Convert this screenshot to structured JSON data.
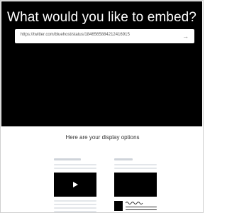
{
  "hero": {
    "title": "What would you like to embed?"
  },
  "url_input": {
    "value": "https://twitter.com/bluehost/status/1846565884212416915",
    "submit_icon": "arrow-right-icon"
  },
  "options": {
    "heading": "Here are your display options",
    "cards": [
      {
        "name": "video-embed-preview",
        "icon": "play-icon"
      },
      {
        "name": "card-embed-preview",
        "icon": "wave-icon"
      }
    ]
  },
  "colors": {
    "hero_background": "#000000",
    "placeholder_line": "#e3e6ea"
  }
}
